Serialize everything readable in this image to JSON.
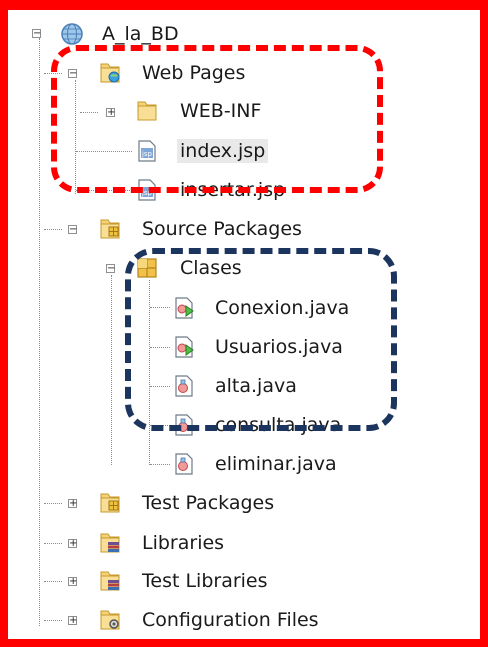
{
  "tree": {
    "project": {
      "label": "A_la_BD",
      "icon": "globe-project-icon",
      "expander": "−"
    },
    "web_pages": {
      "label": "Web Pages",
      "icon": "web-folder-icon",
      "expander": "−",
      "children": [
        {
          "label": "WEB-INF",
          "icon": "folder-icon",
          "expander": "+"
        },
        {
          "label": "index.jsp",
          "icon": "jsp-file-icon",
          "selected": true
        },
        {
          "label": "insertar.jsp",
          "icon": "jsp-file-icon"
        }
      ]
    },
    "source_packages": {
      "label": "Source Packages",
      "icon": "source-folder-icon",
      "expander": "−",
      "package": {
        "label": "Clases",
        "icon": "package-icon",
        "expander": "−",
        "files": [
          {
            "label": "Conexion.java",
            "icon": "java-main-class-icon"
          },
          {
            "label": "Usuarios.java",
            "icon": "java-main-class-icon"
          },
          {
            "label": "alta.java",
            "icon": "java-class-icon"
          },
          {
            "label": "consulta.java",
            "icon": "java-class-icon"
          },
          {
            "label": "eliminar.java",
            "icon": "java-class-icon"
          }
        ]
      }
    },
    "collapsed_nodes": [
      {
        "label": "Test Packages",
        "icon": "test-folder-icon",
        "expander": "+"
      },
      {
        "label": "Libraries",
        "icon": "libraries-icon",
        "expander": "+"
      },
      {
        "label": "Test Libraries",
        "icon": "libraries-icon",
        "expander": "+"
      },
      {
        "label": "Configuration Files",
        "icon": "config-folder-icon",
        "expander": "+"
      }
    ]
  },
  "colors": {
    "background": "#c8f000",
    "outer_frame": "#ff0000",
    "annotation_red": "#ff0000",
    "annotation_navy": "#1c355e"
  }
}
